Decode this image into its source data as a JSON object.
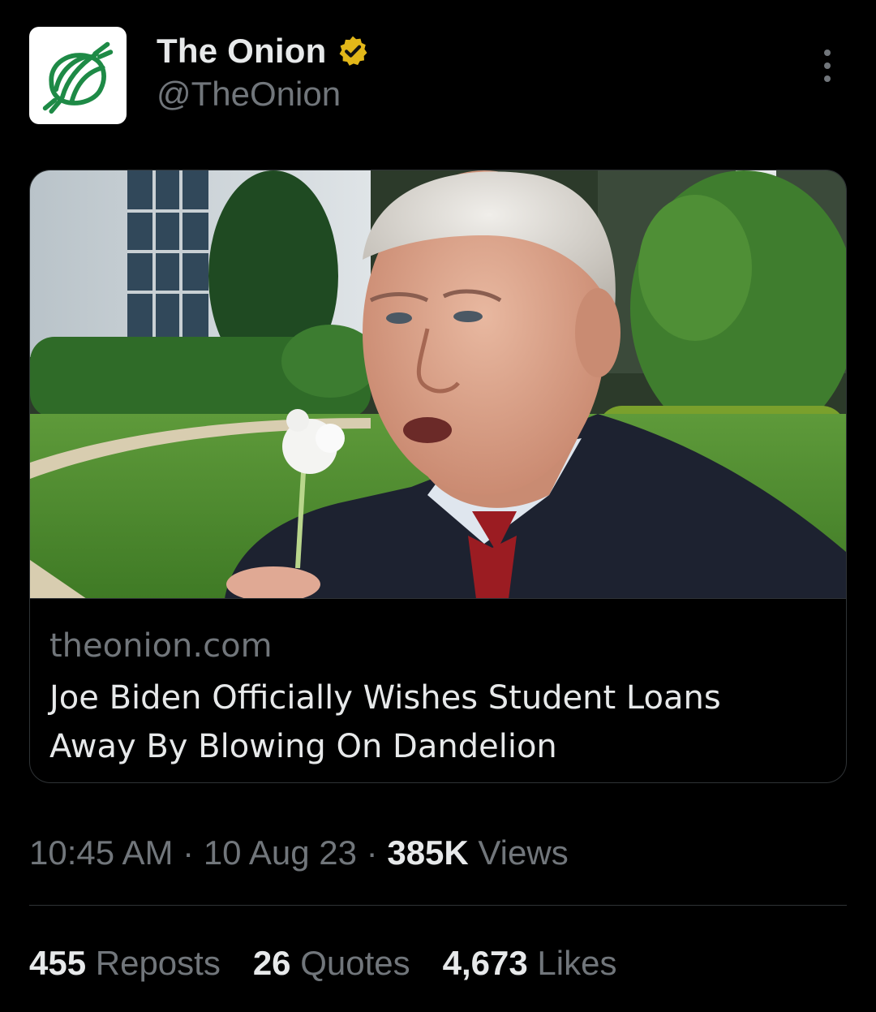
{
  "tweet": {
    "author": {
      "display_name": "The Onion",
      "handle": "@TheOnion",
      "avatar_icon": "onion-logo-icon",
      "verified_icon": "verified-badge-icon",
      "verified_color": "#e2b719",
      "logo_color": "#1e8a46"
    },
    "more_icon": "more-vertical-icon",
    "card": {
      "image": "photo-man-blowing-dandelion-white-house-lawn",
      "domain": "theonion.com",
      "title": "Joe Biden Officially Wishes Student Loans Away By Blowing On Dandelion"
    },
    "meta": {
      "time": "10:45 AM",
      "separator": "·",
      "date": "10 Aug 23",
      "views_count": "385K",
      "views_label": "Views"
    },
    "stats": [
      {
        "count": "455",
        "label": "Reposts"
      },
      {
        "count": "26",
        "label": "Quotes"
      },
      {
        "count": "4,673",
        "label": "Likes"
      }
    ]
  }
}
